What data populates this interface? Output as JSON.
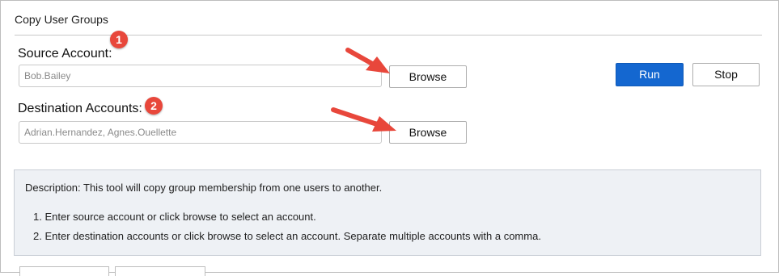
{
  "panel": {
    "title": "Copy User Groups"
  },
  "source": {
    "label": "Source Account:",
    "value": "Bob.Bailey",
    "browse_label": "Browse",
    "badge": "1"
  },
  "destination": {
    "label": "Destination Accounts:",
    "value": "Adrian.Hernandez, Agnes.Ouellette",
    "browse_label": "Browse",
    "badge": "2"
  },
  "actions": {
    "run_label": "Run",
    "stop_label": "Stop"
  },
  "description": {
    "text": "Description: This tool will copy group membership from one users to another.",
    "steps": [
      "1. Enter source account or click browse to select an account.",
      "2. Enter destination accounts or click browse to select an account. Separate multiple accounts with a comma."
    ]
  },
  "colors": {
    "accent": "#1467d0",
    "annotation_red": "#e8473b"
  }
}
